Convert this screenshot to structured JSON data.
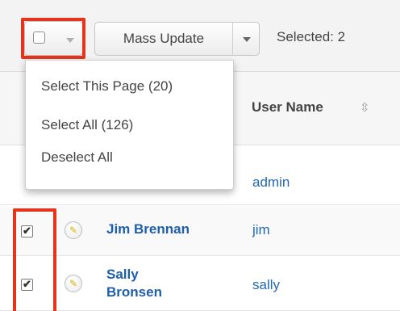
{
  "toolbar": {
    "mass_update_label": "Mass Update",
    "selected_text": "Selected: 2"
  },
  "dropdown": {
    "items": [
      "Select This Page (20)",
      "Select All (126)",
      "Deselect All"
    ]
  },
  "table": {
    "columns": {
      "user_name": "User Name"
    },
    "rows": [
      {
        "full_name": "",
        "user_name": "admin",
        "checked": false
      },
      {
        "full_name": "Jim Brennan",
        "user_name": "jim",
        "checked": true
      },
      {
        "full_name": "Sally\nBronsen",
        "user_name": "sally",
        "checked": true
      }
    ]
  },
  "colors": {
    "highlight": "#e6341c",
    "link": "#1f5ea8"
  },
  "icons": {
    "checkbox_mark": "☑",
    "sort": "⇳",
    "edit": "pencil-icon"
  }
}
